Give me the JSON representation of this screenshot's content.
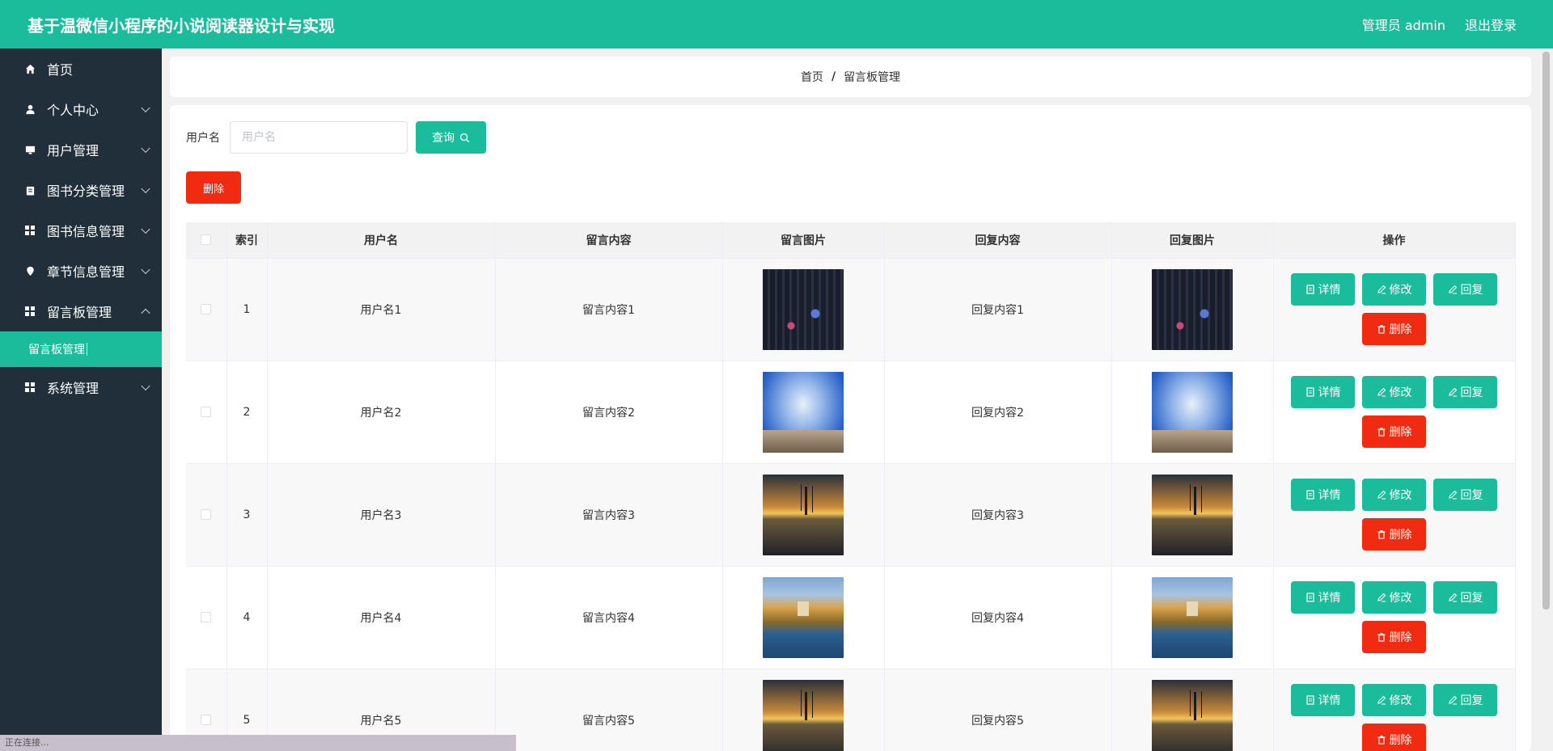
{
  "header": {
    "title": "基于温微信小程序的小说阅读器设计与实现",
    "user_label": "管理员 admin",
    "logout": "退出登录"
  },
  "sidebar": {
    "items": [
      {
        "label": "首页",
        "icon": "home-icon"
      },
      {
        "label": "个人中心",
        "icon": "user-icon"
      },
      {
        "label": "用户管理",
        "icon": "monitor-icon"
      },
      {
        "label": "图书分类管理",
        "icon": "clipboard-icon"
      },
      {
        "label": "图书信息管理",
        "icon": "grid-icon"
      },
      {
        "label": "章节信息管理",
        "icon": "pin-icon"
      },
      {
        "label": "留言板管理",
        "icon": "grid-icon"
      },
      {
        "label": "系统管理",
        "icon": "grid-icon"
      }
    ],
    "active_sub": "留言板管理"
  },
  "breadcrumb": {
    "home": "首页",
    "sep": "/",
    "current": "留言板管理"
  },
  "search": {
    "label": "用户名",
    "placeholder": "用户名",
    "button": "查询"
  },
  "toolbar": {
    "delete": "删除"
  },
  "table": {
    "headers": [
      "索引",
      "用户名",
      "留言内容",
      "留言图片",
      "回复内容",
      "回复图片",
      "操作"
    ],
    "rows": [
      {
        "index": "1",
        "username": "用户名1",
        "content": "留言内容1",
        "reply": "回复内容1"
      },
      {
        "index": "2",
        "username": "用户名2",
        "content": "留言内容2",
        "reply": "回复内容2"
      },
      {
        "index": "3",
        "username": "用户名3",
        "content": "留言内容3",
        "reply": "回复内容3"
      },
      {
        "index": "4",
        "username": "用户名4",
        "content": "留言内容4",
        "reply": "回复内容4"
      },
      {
        "index": "5",
        "username": "用户名5",
        "content": "留言内容5",
        "reply": "回复内容5"
      }
    ],
    "actions": {
      "detail": "详情",
      "edit": "修改",
      "reply": "回复",
      "delete": "删除"
    }
  },
  "status_bar": "正在连接...",
  "colors": {
    "primary": "#1abc9c",
    "danger": "#f02b12",
    "sidebar": "#212f3a"
  }
}
